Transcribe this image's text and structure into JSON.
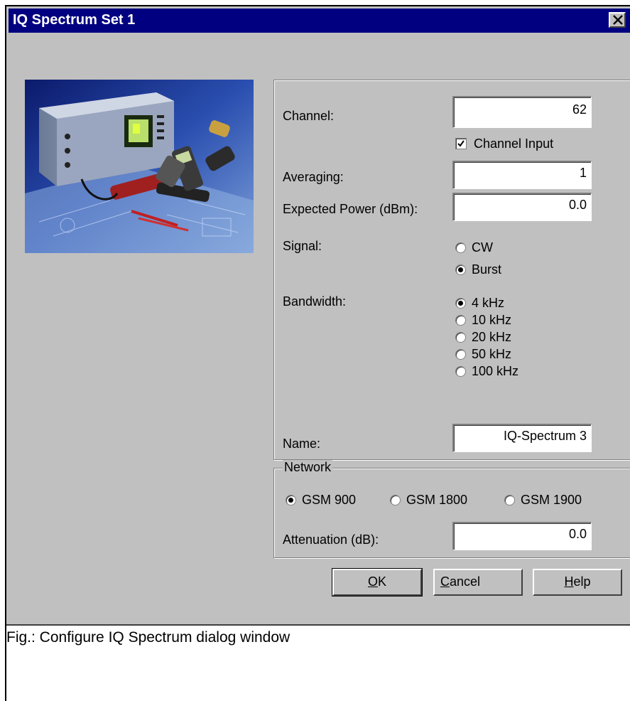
{
  "dialog": {
    "title": "IQ Spectrum Set 1",
    "close_label": "×"
  },
  "photo": {
    "icon": "instrument-photo"
  },
  "fields": {
    "channel": {
      "label": "Channel:",
      "value": "62"
    },
    "channel_input": {
      "label": "Channel Input",
      "checked": true
    },
    "averaging": {
      "label": "Averaging:",
      "value": "1"
    },
    "expected_power": {
      "label": "Expected Power (dBm):",
      "value": "0.0"
    },
    "signal": {
      "label": "Signal:",
      "options": [
        "CW",
        "Burst"
      ],
      "selected": "Burst"
    },
    "bandwidth": {
      "label": "Bandwidth:",
      "options": [
        "4 kHz",
        "10 kHz",
        "20 kHz",
        "50 kHz",
        "100 kHz"
      ],
      "selected": "4 kHz"
    },
    "name": {
      "label": "Name:",
      "value": "IQ-Spectrum 3"
    }
  },
  "network": {
    "legend": "Network",
    "options": [
      "GSM 900",
      "GSM 1800",
      "GSM 1900"
    ],
    "selected": "GSM 900",
    "attenuation": {
      "label": "Attenuation (dB):",
      "value": "0.0"
    }
  },
  "buttons": {
    "ok": {
      "mnemonic": "O",
      "rest": "K"
    },
    "cancel": {
      "mnemonic": "C",
      "rest": "ancel"
    },
    "help": {
      "mnemonic": "H",
      "rest": "elp"
    }
  },
  "caption": "Fig.: Configure IQ Spectrum dialog window"
}
